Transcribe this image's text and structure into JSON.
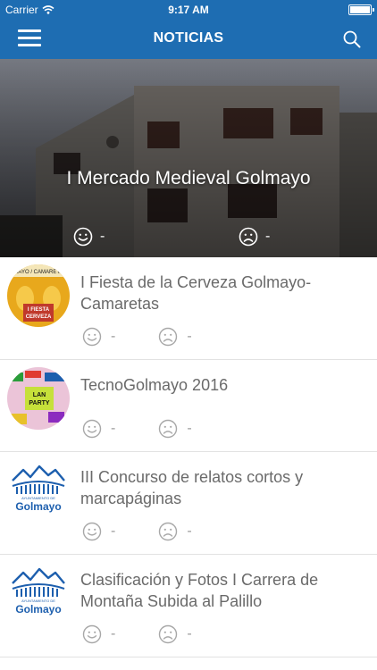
{
  "status_bar": {
    "carrier": "Carrier",
    "time": "9:17 AM"
  },
  "nav": {
    "title": "NOTICIAS"
  },
  "hero": {
    "title": "I Mercado Medieval Golmayo",
    "likes": "-",
    "dislikes": "-"
  },
  "news": [
    {
      "title": "I Fiesta de la Cerveza Golmayo-Camaretas",
      "likes": "-",
      "dislikes": "-",
      "thumb": "poster-cerveza",
      "thumb_text": [
        "MAYO / CAMARETA",
        "I FIESTA",
        "CERVEZA"
      ]
    },
    {
      "title": "TecnoGolmayo 2016",
      "likes": "-",
      "dislikes": "-",
      "thumb": "poster-lan-party",
      "thumb_text": [
        "LAN",
        "PARTY"
      ]
    },
    {
      "title": "III Concurso de relatos cortos y marcapáginas",
      "likes": "-",
      "dislikes": "-",
      "thumb": "logo-golmayo",
      "thumb_text": [
        "AYUNTAMIENTO DE",
        "Golmayo"
      ]
    },
    {
      "title": "Clasificación y Fotos I Carrera de Montaña Subida al Palillo",
      "likes": "-",
      "dislikes": "-",
      "thumb": "logo-golmayo",
      "thumb_text": [
        "AYUNTAMIENTO DE",
        "Golmayo"
      ]
    }
  ],
  "colors": {
    "primary": "#1e6db2",
    "text": "#6a6a6a",
    "muted": "#9b9b9b"
  }
}
